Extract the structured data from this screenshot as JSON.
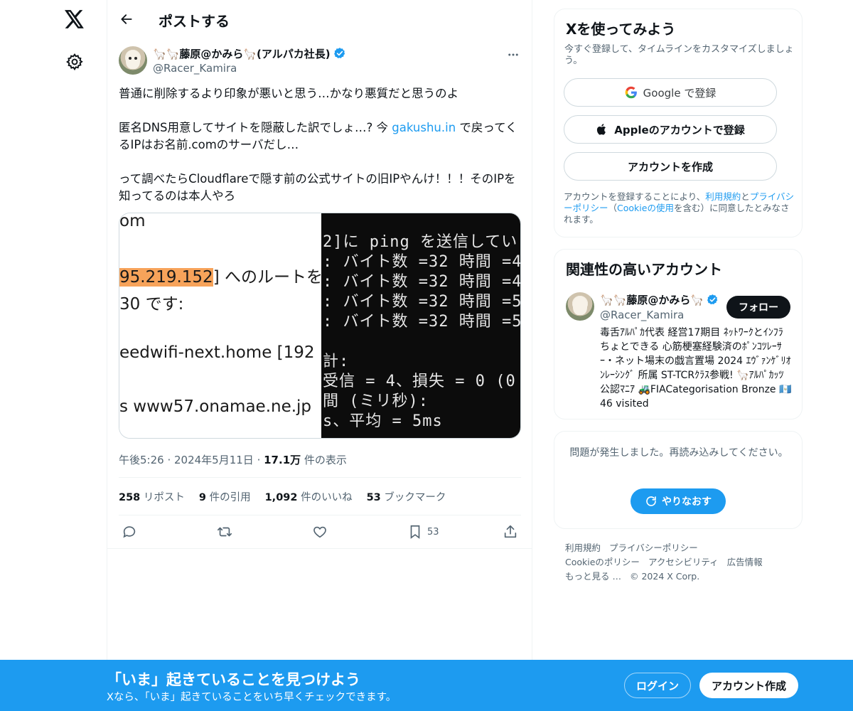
{
  "nav": {
    "logo_icon": "x-logo-icon",
    "settings_icon": "gear-icon"
  },
  "header": {
    "title": "ポストする",
    "back_icon": "arrow-left-icon"
  },
  "post": {
    "author_name": "🦙🦙藤原@かみら🦙(アルパカ社長)",
    "author_handle": "@Racer_Kamira",
    "text_line1": "普通に削除するより印象が悪いと思う…かなり悪質だと思うのよ",
    "text_line2a": "匿名DNS用意してサイトを隠蔽した訳でしょ…? 今 ",
    "text_link": "gakushu.in",
    "text_line2b": " で戻ってくるIPはお名前.comのサーバだし…",
    "text_line3": "って調べたらCloudflareで隠す前の公式サイトの旧IPやんけ！！！そのIPを知ってるのは本人やろ",
    "image_left": {
      "l1": "om",
      "l2_hl": "95.219.152",
      "l2_rest": "] へのルートを",
      "l3": " 30 です:",
      "l4": "eedwifi-next.home [192",
      "l5": "s www57.onamae.ne.jp"
    },
    "image_right": {
      "l1": "2]に  ping を送信してい",
      "l2": ": バイト数 =32 時間 =4",
      "l3": ": バイト数 =32 時間 =4",
      "l4": ": バイト数 =32 時間 =5",
      "l5": ": バイト数 =32 時間 =5",
      "l6": "計:",
      "l7": " 受信 = 4、損失 = 0 (0",
      "l8": "間 (ミリ秒):",
      "l9": "s、平均 = 5ms"
    },
    "time": "午後5:26",
    "date": "2024年5月11日",
    "views_count": "17.1万",
    "views_label": " 件の表示",
    "stats": {
      "reposts_count": "258",
      "reposts_label": " リポスト",
      "quotes_count": "9",
      "quotes_label": " 件の引用",
      "likes_count": "1,092",
      "likes_label": " 件のいいね",
      "bookmarks_count": "53",
      "bookmarks_label": " ブックマーク"
    },
    "bookmark_action_count": "53"
  },
  "signup": {
    "title": "Xを使ってみよう",
    "subtitle": "今すぐ登録して、タイムラインをカスタマイズしましょう。",
    "google_label": "Google",
    "google_suffix": " で登録",
    "apple_label": "Appleのアカウントで登録",
    "create_label": "アカウントを作成",
    "legal_pre": "アカウントを登録することにより、",
    "legal_terms": "利用規約",
    "legal_and": "と",
    "legal_privacy": "プライバシーポリシー",
    "legal_open": "（",
    "legal_cookie": "Cookieの使用",
    "legal_post": "を含む）に同意したとみなされます。"
  },
  "related": {
    "title": "関連性の高いアカウント",
    "name": "🦙🦙藤原@かみら🦙",
    "handle": "@Racer_Kamira",
    "follow_label": "フォロー",
    "bio": "毒舌ｱﾙﾊﾟｶ代表 経営17期目 ﾈｯﾄﾜｰｸとｲﾝﾌﾗちょとできる 心筋梗塞経験済のﾎﾟﾝｺﾂﾚｰｻｰ・ネット場末の戯言置場 2024 ｴｳﾞｧﾝｹﾞﾘｵﾝﾚｰｼﾝｸﾞ 所属 ST-TCRｸﾗｽ参戦! 🦙ｱﾙﾊﾟｶｯﾂ 公認ﾏﾆｱ 🚜FIACategorisation Bronze 🇬🇹46 visited"
  },
  "error": {
    "text": "問題が発生しました。再読み込みしてください。",
    "retry_label": "やりなおす"
  },
  "footer": {
    "links": [
      "利用規約",
      "プライバシーポリシー",
      "Cookieのポリシー",
      "アクセシビリティ",
      "広告情報",
      "もっと見る …",
      "© 2024 X Corp."
    ]
  },
  "banner": {
    "title": "「いま」起きていることを見つけよう",
    "subtitle": "Xなら、「いま」起きていることをいち早くチェックできます。",
    "login_label": "ログイン",
    "signup_label": "アカウント作成"
  },
  "colors": {
    "accent": "#1d9bf0",
    "text": "#0f1419",
    "muted": "#536471",
    "highlight": "#f7a35a"
  }
}
